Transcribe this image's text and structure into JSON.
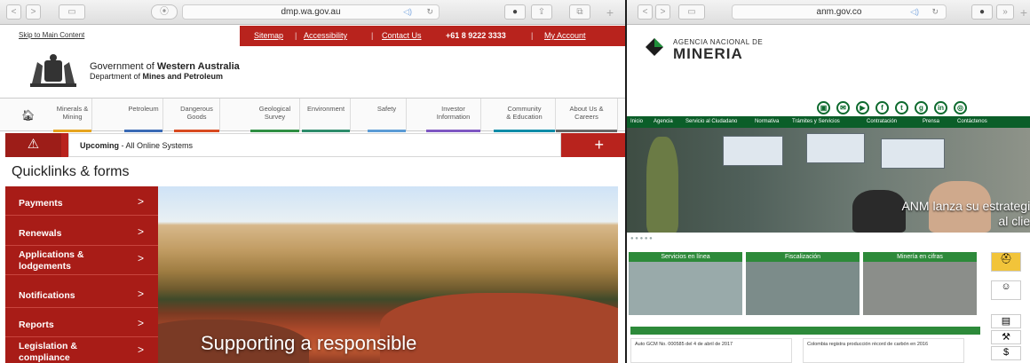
{
  "left": {
    "toolbar": {
      "back": "<",
      "forward": ">",
      "url": "dmp.wa.gov.au",
      "reload": "↻",
      "plus": "+"
    },
    "skip": "Skip to Main Content",
    "toplinks": [
      "Sitemap",
      "Accessibility",
      "Contact Us"
    ],
    "phone": "+61 8 9222 3333",
    "account": "My Account",
    "gov_line1a": "Government of ",
    "gov_line1b": "Western Australia",
    "gov_line2a": "Department of ",
    "gov_line2b": "Mines and Petroleum",
    "nav": [
      {
        "label": "Minerals &\nMining",
        "color": "#e6a51f"
      },
      {
        "label": "Petroleum",
        "color": "#3a6ab5"
      },
      {
        "label": "Dangerous\nGoods",
        "color": "#d84a20"
      },
      {
        "label": "Geological\nSurvey",
        "color": "#2f8f43"
      },
      {
        "label": "Environment",
        "color": "#2d8c6b"
      },
      {
        "label": "Safety",
        "color": "#5b9bd5"
      },
      {
        "label": "Investor\nInformation",
        "color": "#7e57c2"
      },
      {
        "label": "Community\n& Education",
        "color": "#0f8ca8"
      },
      {
        "label": "About Us &\nCareers",
        "color": "#666666"
      }
    ],
    "alert_bold": "Upcoming",
    "alert_rest": " - All Online Systems",
    "quicklinks_title": "Quicklinks & forms",
    "sidebar": [
      "Payments",
      "Renewals",
      "Applications &\nlodgements",
      "Notifications",
      "Reports",
      "Legislation &\ncompliance"
    ],
    "hero_caption": "Supporting a responsible"
  },
  "right": {
    "toolbar": {
      "url": "anm.gov.co",
      "plus": "+"
    },
    "logo_line1": "AGENCIA NACIONAL DE",
    "logo_line2": "MINERIA",
    "nav": [
      "Inicio",
      "Agencia",
      "Servicio al Ciudadano",
      "Normativa",
      "Trámites y Servicios",
      "Contratación",
      "Prensa",
      "Contáctenos"
    ],
    "slide_caption1": "ANM lanza su estrategia",
    "slide_caption2": "al clien",
    "cards": [
      "Servicios en línea",
      "Fiscalización",
      "Minería en cifras"
    ],
    "news": [
      "Auto GCM No. 000585 del 4 de abril de 2017",
      "Colombia registra producción récord de carbón en 2016"
    ]
  }
}
